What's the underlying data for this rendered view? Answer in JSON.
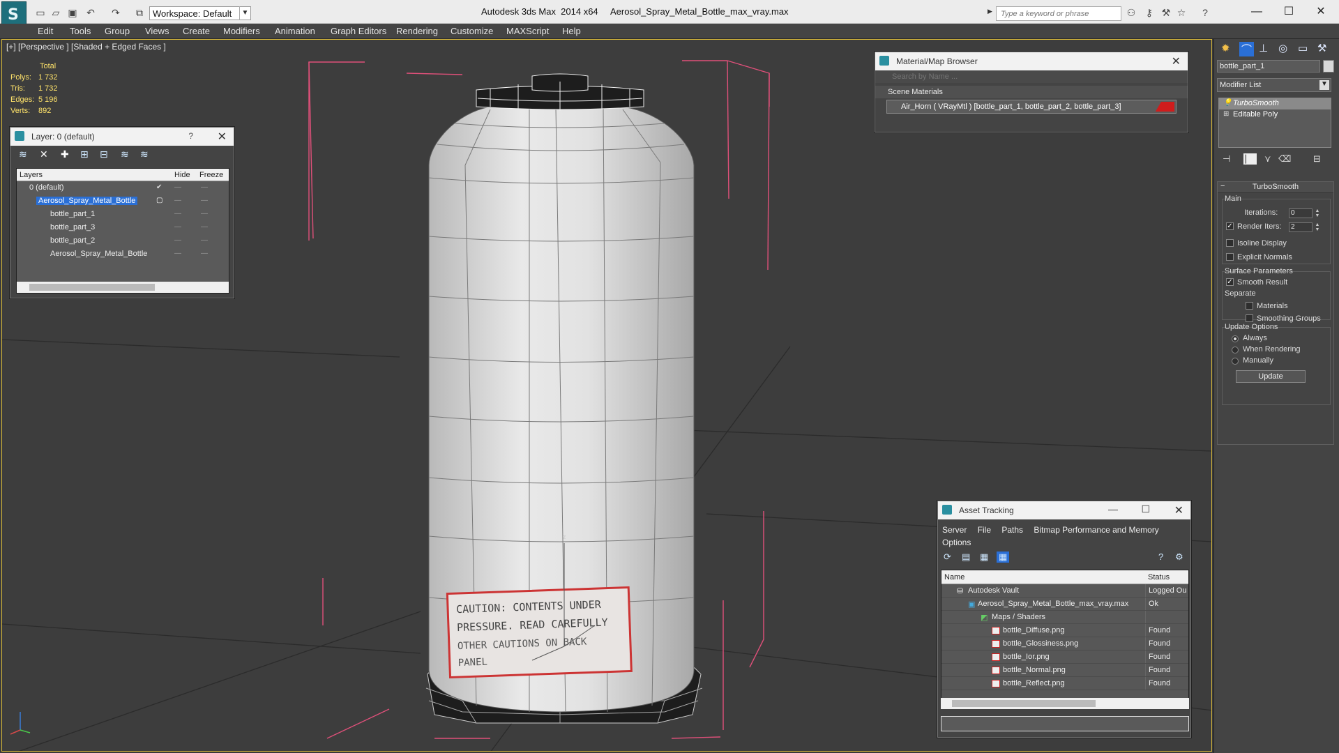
{
  "titlebar": {
    "workspace": "Workspace: Default",
    "app_title": "Autodesk 3ds Max  2014 x64     Aerosol_Spray_Metal_Bottle_max_vray.max",
    "search_placeholder": "Type a keyword or phrase"
  },
  "menu": [
    "Edit",
    "Tools",
    "Group",
    "Views",
    "Create",
    "Modifiers",
    "Animation",
    "Graph Editors",
    "Rendering",
    "Customize",
    "MAXScript",
    "Help"
  ],
  "viewport": {
    "label": "[+] [Perspective ] [Shaded + Edged Faces ]",
    "stats": {
      "total_label": "Total",
      "rows": [
        {
          "key": "Polys:",
          "value": "1 732"
        },
        {
          "key": "Tris:",
          "value": "1 732"
        },
        {
          "key": "Edges:",
          "value": "5 196"
        },
        {
          "key": "Verts:",
          "value": "892"
        }
      ]
    },
    "axis_label": "z"
  },
  "layer_panel": {
    "title": "Layer: 0 (default)",
    "help": "?",
    "col_layers": "Layers",
    "col_hide": "Hide",
    "col_freeze": "Freeze",
    "rows": [
      {
        "name": "0 (default)"
      },
      {
        "name": "Aerosol_Spray_Metal_Bottle"
      },
      {
        "name": "bottle_part_1"
      },
      {
        "name": "bottle_part_3"
      },
      {
        "name": "bottle_part_2"
      },
      {
        "name": "Aerosol_Spray_Metal_Bottle"
      }
    ]
  },
  "material_browser": {
    "title": "Material/Map Browser",
    "search_placeholder": "Search by Name ...",
    "section": "Scene Materials",
    "item": "Air_Horn  ( VRayMtl ) [bottle_part_1, bottle_part_2, bottle_part_3]"
  },
  "asset_tracking": {
    "title": "Asset Tracking",
    "menu": [
      "Server",
      "File",
      "Paths",
      "Bitmap Performance and Memory",
      "Options"
    ],
    "col_name": "Name",
    "col_status": "Status",
    "rows": [
      {
        "name": "Autodesk Vault",
        "status": "Logged Ou"
      },
      {
        "name": "Aerosol_Spray_Metal_Bottle_max_vray.max",
        "status": "Ok"
      },
      {
        "name": "Maps / Shaders",
        "status": ""
      },
      {
        "name": "bottle_Diffuse.png",
        "status": "Found"
      },
      {
        "name": "bottle_Glossiness.png",
        "status": "Found"
      },
      {
        "name": "bottle_Ior.png",
        "status": "Found"
      },
      {
        "name": "bottle_Normal.png",
        "status": "Found"
      },
      {
        "name": "bottle_Reflect.png",
        "status": "Found"
      }
    ]
  },
  "command_panel": {
    "object_name": "bottle_part_1",
    "modifier_list": "Modifier List",
    "stack": [
      "TurboSmooth",
      "Editable Poly"
    ],
    "rollout_title": "TurboSmooth",
    "main_label": "Main",
    "iterations_label": "Iterations:",
    "iterations_value": "0",
    "render_iters_label": "Render Iters:",
    "render_iters_value": "2",
    "isoline_label": "Isoline Display",
    "explicit_normals_label": "Explicit Normals",
    "surface_params_label": "Surface Parameters",
    "smooth_result_label": "Smooth Result",
    "separate_label": "Separate",
    "materials_label": "Materials",
    "smoothing_groups_label": "Smoothing Groups",
    "update_options_label": "Update Options",
    "always_label": "Always",
    "when_rendering_label": "When Rendering",
    "manually_label": "Manually",
    "update_button": "Update"
  },
  "bottle_label_text": [
    "CAUTION: CONTENTS UNDER",
    "PRESSURE. READ CAREFULLY",
    "OTHER CAUTIONS ON BACK",
    "PANEL"
  ],
  "colors": {
    "accent": "#2a6fd6",
    "viewport_border": "#d9b93a",
    "bounding_box": "#e0507a",
    "stats_text": "#ffe36a"
  }
}
